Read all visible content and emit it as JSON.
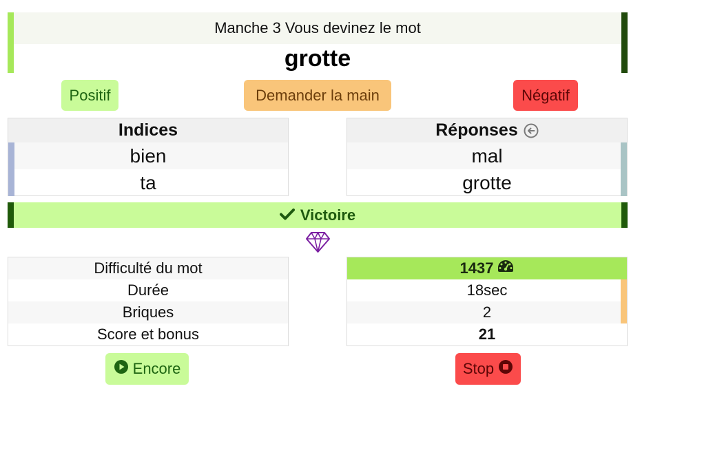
{
  "header": {
    "subtitle": "Manche 3 Vous devinez le mot",
    "word": "grotte"
  },
  "actions": {
    "positif": "Positif",
    "demander_main": "Demander la main",
    "negatif": "Négatif"
  },
  "indices": {
    "title": "Indices",
    "items": [
      "bien",
      "ta"
    ]
  },
  "reponses": {
    "title": "Réponses",
    "icon": "arrow-left-circle-icon",
    "items": [
      "mal",
      "grotte"
    ]
  },
  "victory": {
    "label": "Victoire",
    "icon": "check-icon"
  },
  "gem_icon": "diamond-icon",
  "stats": {
    "labels": [
      "Difficulté du mot",
      "Durée",
      "Briques",
      "Score et bonus"
    ],
    "values": [
      "1437",
      "18sec",
      "2",
      "21"
    ],
    "difficulty_icon": "gauge-icon"
  },
  "bottom": {
    "encore": "Encore",
    "stop": "Stop"
  },
  "colors": {
    "green_light": "#c9fb99",
    "green_bright": "#a6e85a",
    "dark_green": "#214a0c",
    "orange": "#f9c57a",
    "red": "#fb4b4b",
    "purple": "#7b1fa2"
  }
}
